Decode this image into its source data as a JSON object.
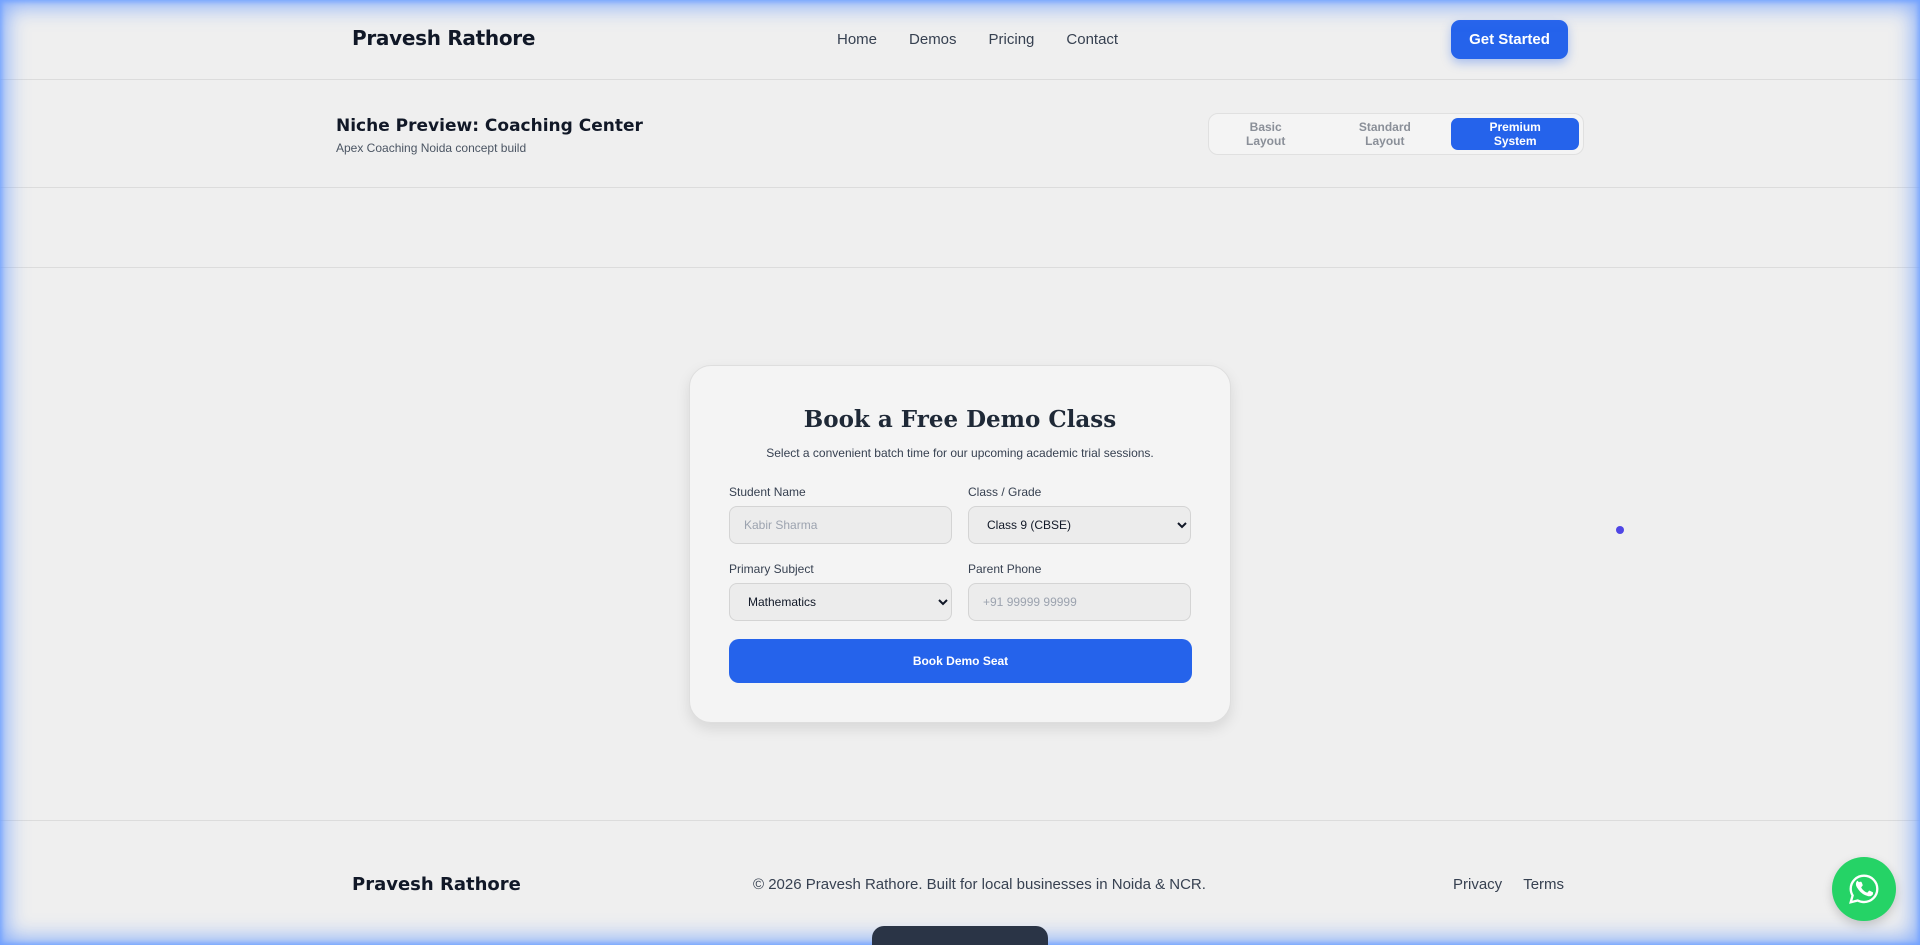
{
  "header": {
    "brand": "Pravesh Rathore",
    "nav": [
      "Home",
      "Demos",
      "Pricing",
      "Contact"
    ],
    "cta": "Get Started"
  },
  "niche": {
    "title": "Niche Preview: Coaching Center",
    "subtitle": "Apex Coaching Noida concept build",
    "layouts": [
      "Basic Layout",
      "Standard Layout",
      "Premium System"
    ],
    "active_layout": "Premium System"
  },
  "form": {
    "title": "Book a Free Demo Class",
    "description": "Select a convenient batch time for our upcoming academic trial sessions.",
    "student_name": {
      "label": "Student Name",
      "placeholder": "Kabir Sharma"
    },
    "class_grade": {
      "label": "Class / Grade",
      "value": "Class 9 (CBSE)"
    },
    "subject": {
      "label": "Primary Subject",
      "value": "Mathematics"
    },
    "phone": {
      "label": "Parent Phone",
      "placeholder": "+91 99999 99999"
    },
    "submit": "Book Demo Seat"
  },
  "footer": {
    "brand": "Pravesh Rathore",
    "copyright": "© 2026 Pravesh Rathore. Built for local businesses in Noida & NCR.",
    "links": [
      "Privacy",
      "Terms"
    ]
  },
  "icons": {
    "whatsapp": "whatsapp-icon"
  },
  "colors": {
    "accent": "#2563eb",
    "whatsapp": "#25d366",
    "dot": "#4f46e5"
  }
}
